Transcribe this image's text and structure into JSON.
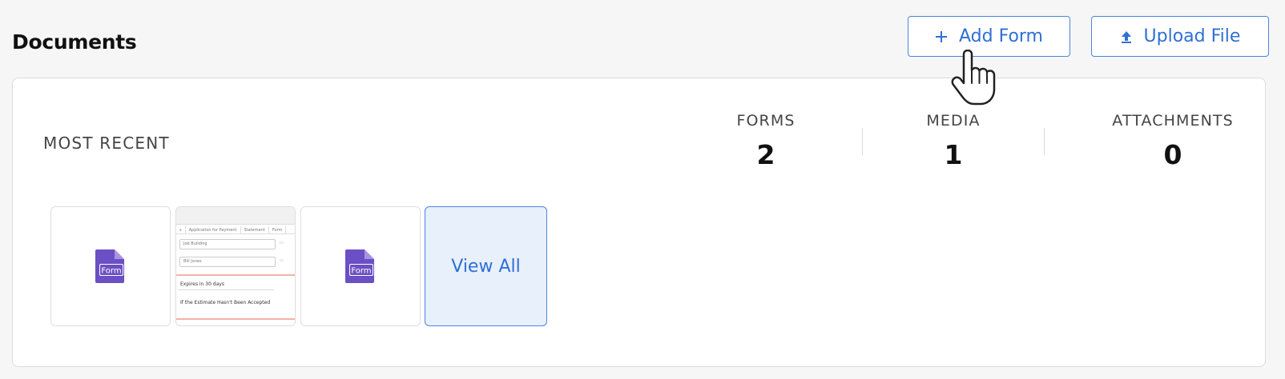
{
  "header": {
    "title": "Documents",
    "add_form": {
      "icon": "plus-icon",
      "label": "Add Form"
    },
    "upload_file": {
      "icon": "upload-icon",
      "label": "Upload File"
    }
  },
  "summary": {
    "section_label": "MOST RECENT",
    "stats": [
      {
        "label": "FORMS",
        "value": "2"
      },
      {
        "label": "MEDIA",
        "value": "1"
      },
      {
        "label": "ATTACHMENTS",
        "value": "0"
      }
    ]
  },
  "thumbnails": {
    "form_icon_text": "Form",
    "preview": {
      "tabs": [
        "s",
        "Application for Payment",
        "Statement",
        "Form"
      ],
      "field_1": "Job Building",
      "field_2": "Bill Jones",
      "select_1": "Expires in 30 days",
      "select_2": "If the Estimate Hasn't Been Accepted"
    },
    "view_all_label": "View All"
  },
  "colors": {
    "accent": "#2f6fd6",
    "form_icon": "#6b4fc4",
    "view_all_bg": "#e8f0fb"
  }
}
